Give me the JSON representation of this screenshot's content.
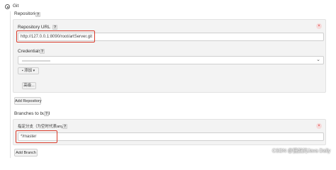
{
  "scm": {
    "label": "Git"
  },
  "repositories": {
    "heading": "Repositories",
    "help": "?",
    "url_label": "Repository URL",
    "url_value": "http://127.0.0.1:8090/root/artServer.git",
    "credentials_label": "Credentials",
    "add_label": "添加",
    "advanced_label": "高级...",
    "add_repository_label": "Add Repository",
    "remove_symbol": "×",
    "select_arrow": "⌄"
  },
  "branches": {
    "heading": "Branches to build",
    "help": "?",
    "specifier_label": "指定分支（为空时代表any）",
    "specifier_value": "*/master",
    "add_branch_label": "Add Branch",
    "remove_symbol": "×"
  },
  "watermark": "CSDN @猫奴的Java Daily",
  "colors": {
    "highlight_border": "#d93b2b",
    "panel_bg": "#f3f3f3"
  }
}
